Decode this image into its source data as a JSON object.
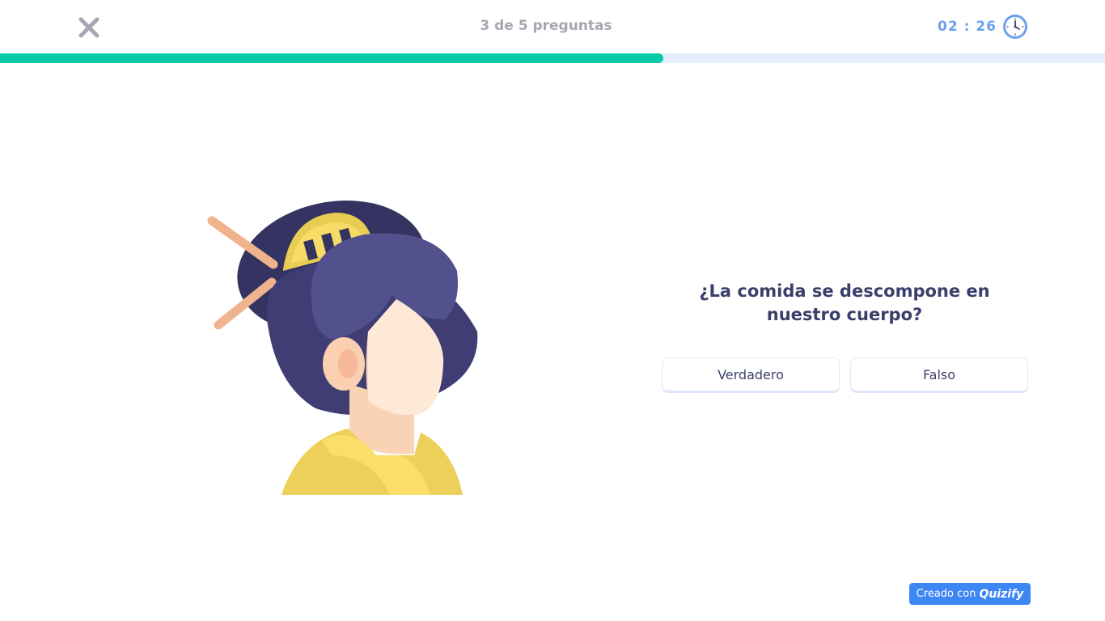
{
  "header": {
    "progress_text": "3 de 5 preguntas",
    "timer": "02 : 26",
    "close_icon": "close-icon",
    "clock_icon": "clock-icon"
  },
  "progress": {
    "fraction": 0.6,
    "fill_color": "#0acaa7",
    "track_color": "#e6eefb"
  },
  "illustration": {
    "icon": "geisha-woman-illustration"
  },
  "question": {
    "text": "¿La comida se descompone en nuestro cuerpo?"
  },
  "answers": [
    {
      "label": "Verdadero"
    },
    {
      "label": "Falso"
    }
  ],
  "footer": {
    "badge_prefix": "Creado con",
    "badge_brand": "Quizify",
    "badge_color": "#3d87f5"
  }
}
